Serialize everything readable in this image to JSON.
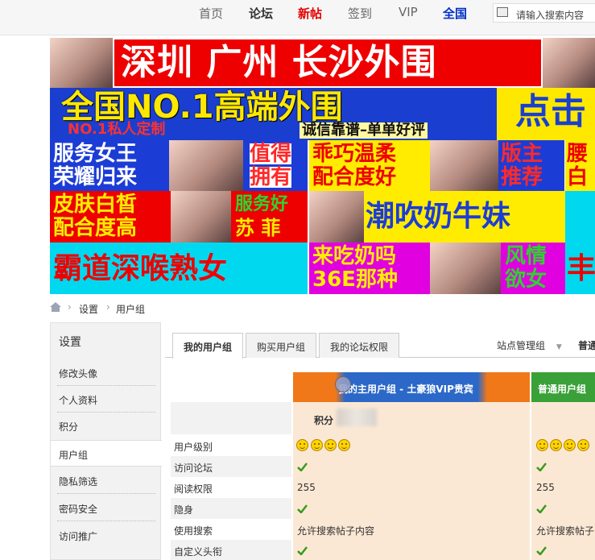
{
  "nav": {
    "items": [
      "首页",
      "论坛",
      "新帖",
      "签到",
      "VIP",
      "全国"
    ],
    "search_placeholder": "请输入搜索内容"
  },
  "banners": {
    "b1": "深圳 广州 长沙外围",
    "b2_main": "全国NO.1高端外围",
    "b2_sub1": "NO.1私人定制",
    "b2_sub2": "诚信靠谱–单单好评",
    "b2_cta": "点击",
    "b3": [
      "服务女王",
      "荣耀归来",
      "值得",
      "拥有",
      "乖巧温柔",
      "配合度好",
      "版主",
      "推荐",
      "腰",
      "白"
    ],
    "b4": [
      "皮肤白皙",
      "配合度高",
      "服务好",
      "苏 菲",
      "潮吹奶牛妹"
    ],
    "b5": [
      "霸道深喉熟女",
      "来吃奶吗",
      "36E那种",
      "风情",
      "欲女",
      "丰"
    ]
  },
  "breadcrumb": [
    "设置",
    "用户组"
  ],
  "sidebar": {
    "heading": "设置",
    "items": [
      "修改头像",
      "个人资料",
      "积分",
      "用户组",
      "隐私筛选",
      "密码安全",
      "访问推广"
    ]
  },
  "tabs": [
    "我的用户组",
    "购买用户组",
    "我的论坛权限"
  ],
  "group_select": {
    "label": "站点管理组",
    "right": "普通"
  },
  "columns": {
    "main_title": "我的主用户组 - 土豪狼VIP贵宾",
    "normal_title": "普通用户组",
    "points_label": "积分"
  },
  "rows": [
    {
      "label": "用户级别",
      "main": "",
      "normal": ""
    },
    {
      "label": "访问论坛",
      "main": "",
      "normal": ""
    },
    {
      "label": "阅读权限",
      "main": "255",
      "normal": "255"
    },
    {
      "label": "隐身",
      "main": "",
      "normal": ""
    },
    {
      "label": "使用搜索",
      "main": "允许搜索帖子内容",
      "normal": "允许搜索帖子"
    },
    {
      "label": "自定义头衔",
      "main": "",
      "normal": ""
    }
  ],
  "colors": {
    "accent_red": "#e40000",
    "nav_blue": "#0030c8",
    "check_green": "#3a9a1c",
    "col_main": "#f07818",
    "col_normal": "#3aa038"
  }
}
